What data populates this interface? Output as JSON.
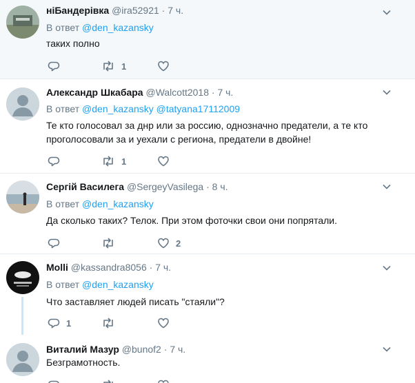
{
  "replies": [
    {
      "name": "ніБандерівка",
      "handle": "@ira52921",
      "time": "7 ч.",
      "replying_prefix": "В ответ",
      "mentions": [
        "@den_kazansky"
      ],
      "text": "таких полно",
      "reply_count": "",
      "retweet_count": "1",
      "like_count": "",
      "avatar": "landscape-photo"
    },
    {
      "name": "Александр Шкабара",
      "handle": "@Walcott2018",
      "time": "7 ч.",
      "replying_prefix": "В ответ",
      "mentions": [
        "@den_kazansky",
        "@tatyana17112009"
      ],
      "text": "Те кто голосовал за днр или за россию, однозначно предатели, а те кто проголосовали за  и уехали с региона, предатели в двойне!",
      "reply_count": "",
      "retweet_count": "1",
      "like_count": "",
      "avatar": "default-egg"
    },
    {
      "name": "Сергій Василега",
      "handle": "@SergeyVasilega",
      "time": "8 ч.",
      "replying_prefix": "В ответ",
      "mentions": [
        "@den_kazansky"
      ],
      "text": "Да сколько таких? Телок. При этом фоточки свои они попрятали.",
      "reply_count": "",
      "retweet_count": "",
      "like_count": "2",
      "avatar": "beach-photo"
    },
    {
      "name": "Molli",
      "handle": "@kassandra8056",
      "time": "7 ч.",
      "replying_prefix": "В ответ",
      "mentions": [
        "@den_kazansky"
      ],
      "text": "Что заставляет людей писать \"стаяли\"?",
      "reply_count": "1",
      "retweet_count": "",
      "like_count": "",
      "avatar": "dark-logo"
    },
    {
      "name": "Виталий Мазур",
      "handle": "@bunof2",
      "time": "7 ч.",
      "replying_prefix": "",
      "mentions": [],
      "text": "Безграмотность.",
      "reply_count": "",
      "retweet_count": "",
      "like_count": "",
      "avatar": "default-egg"
    }
  ],
  "dot": "·",
  "colors": {
    "link": "#1da1f2",
    "muted": "#657786",
    "thread": "#c4e7fb",
    "highlight_bg": "#f5f8fa"
  }
}
